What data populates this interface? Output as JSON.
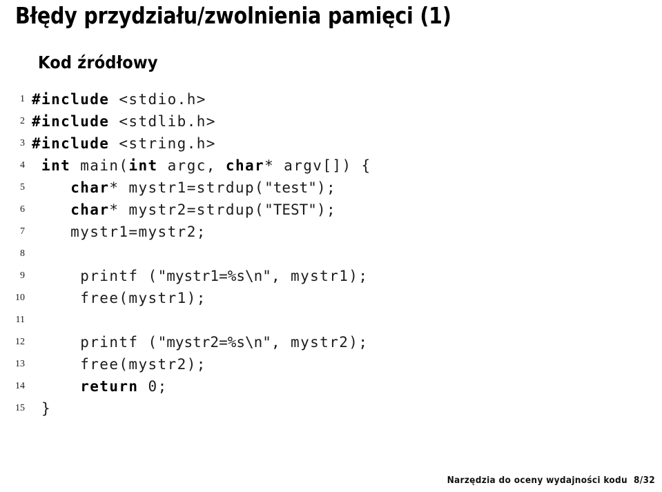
{
  "slide": {
    "title": "Błędy przydziału/zwolnienia pamięci (1)",
    "block_heading": "Kod źródłowy",
    "footer_text": "Narzędzia do oceny wydajności kodu",
    "footer_page": "8/32"
  },
  "code": {
    "language": "C",
    "lines": [
      {
        "no": "1",
        "indent": 0,
        "parts": [
          {
            "t": "#include ",
            "s": "pp"
          },
          {
            "t": "<stdio.h>",
            "s": "plain"
          }
        ]
      },
      {
        "no": "2",
        "indent": 0,
        "parts": [
          {
            "t": "#include ",
            "s": "pp"
          },
          {
            "t": "<stdlib.h>",
            "s": "plain"
          }
        ]
      },
      {
        "no": "3",
        "indent": 0,
        "parts": [
          {
            "t": "#include ",
            "s": "pp"
          },
          {
            "t": "<string.h>",
            "s": "plain"
          }
        ]
      },
      {
        "no": "4",
        "indent": 0,
        "parts": [
          {
            "t": " ",
            "s": "plain"
          },
          {
            "t": "int",
            "s": "kw"
          },
          {
            "t": " main(",
            "s": "plain"
          },
          {
            "t": "int",
            "s": "kw"
          },
          {
            "t": " argc, ",
            "s": "plain"
          },
          {
            "t": "char",
            "s": "kw"
          },
          {
            "t": "* argv[]) {",
            "s": "plain"
          }
        ]
      },
      {
        "no": "5",
        "indent": 0,
        "parts": [
          {
            "t": "    ",
            "s": "plain"
          },
          {
            "t": "char",
            "s": "kw"
          },
          {
            "t": "* mystr1=strdup(",
            "s": "plain"
          },
          {
            "t": "\"test\"",
            "s": "str"
          },
          {
            "t": ");",
            "s": "plain"
          }
        ]
      },
      {
        "no": "6",
        "indent": 0,
        "parts": [
          {
            "t": "    ",
            "s": "plain"
          },
          {
            "t": "char",
            "s": "kw"
          },
          {
            "t": "* mystr2=strdup(",
            "s": "plain"
          },
          {
            "t": "\"TEST\"",
            "s": "str"
          },
          {
            "t": ");",
            "s": "plain"
          }
        ]
      },
      {
        "no": "7",
        "indent": 0,
        "parts": [
          {
            "t": "    mystr1=mystr2;",
            "s": "plain"
          }
        ]
      },
      {
        "no": "8",
        "indent": 0,
        "parts": [
          {
            "t": "",
            "s": "plain"
          }
        ]
      },
      {
        "no": "9",
        "indent": 0,
        "parts": [
          {
            "t": "     printf (",
            "s": "plain"
          },
          {
            "t": "\"mystr1=%s\\n\"",
            "s": "str"
          },
          {
            "t": ", mystr1);",
            "s": "plain"
          }
        ]
      },
      {
        "no": "10",
        "indent": 0,
        "parts": [
          {
            "t": "     free(mystr1);",
            "s": "plain"
          }
        ]
      },
      {
        "no": "11",
        "indent": 0,
        "parts": [
          {
            "t": "",
            "s": "plain"
          }
        ]
      },
      {
        "no": "12",
        "indent": 0,
        "parts": [
          {
            "t": "     printf (",
            "s": "plain"
          },
          {
            "t": "\"mystr2=%s\\n\"",
            "s": "str"
          },
          {
            "t": ", mystr2);",
            "s": "plain"
          }
        ]
      },
      {
        "no": "13",
        "indent": 0,
        "parts": [
          {
            "t": "     free(mystr2);",
            "s": "plain"
          }
        ]
      },
      {
        "no": "14",
        "indent": 0,
        "parts": [
          {
            "t": "     ",
            "s": "plain"
          },
          {
            "t": "return",
            "s": "kw"
          },
          {
            "t": " 0;",
            "s": "plain"
          }
        ]
      },
      {
        "no": "15",
        "indent": 0,
        "parts": [
          {
            "t": " }",
            "s": "plain"
          }
        ]
      }
    ]
  }
}
